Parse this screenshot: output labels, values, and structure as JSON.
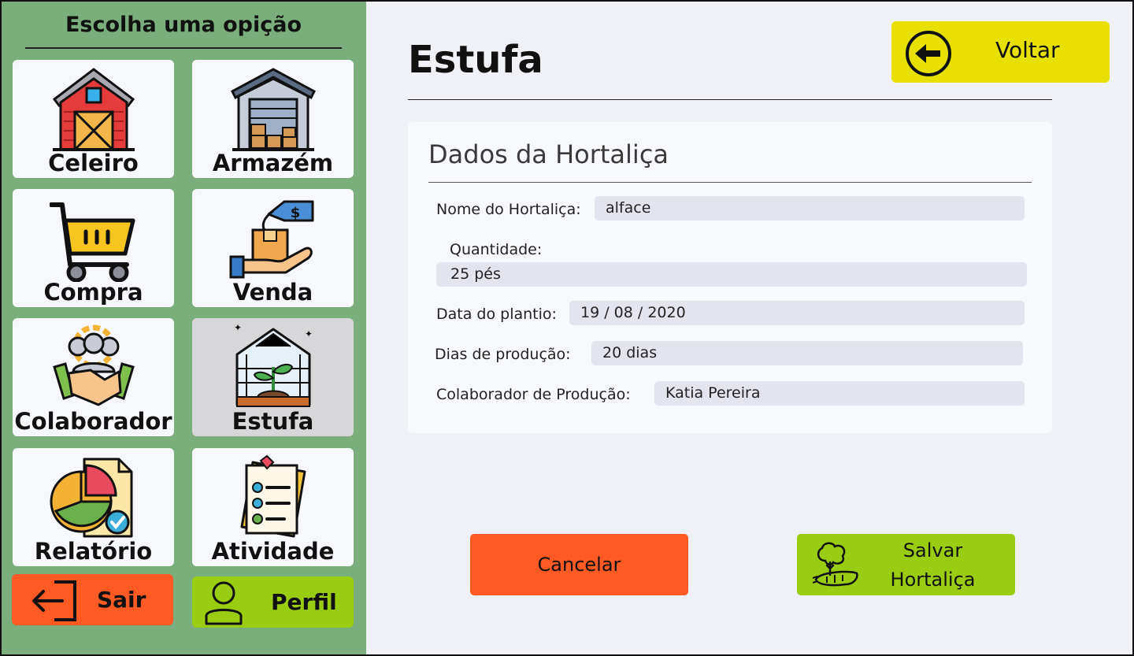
{
  "sidebar": {
    "title": "Escolha uma opição",
    "tiles": [
      {
        "label": "Celeiro",
        "icon": "barn-icon"
      },
      {
        "label": "Armazém",
        "icon": "warehouse-icon"
      },
      {
        "label": "Compra",
        "icon": "shopping-cart-icon"
      },
      {
        "label": "Venda",
        "icon": "sale-box-hand-icon"
      },
      {
        "label": "Colaborador",
        "icon": "handshake-team-icon"
      },
      {
        "label": "Estufa",
        "icon": "greenhouse-icon"
      },
      {
        "label": "Relatório",
        "icon": "report-chart-icon"
      },
      {
        "label": "Atividade",
        "icon": "checklist-icon"
      }
    ],
    "active": "Estufa",
    "logout_label": "Sair",
    "profile_label": "Perfil"
  },
  "header": {
    "title": "Estufa",
    "back_label": "Voltar"
  },
  "form": {
    "title": "Dados da Hortaliça",
    "fields": {
      "name": {
        "label": "Nome do Hortaliça:",
        "value": "alface"
      },
      "quantity": {
        "label": "Quantidade:",
        "value": "25 pés"
      },
      "plant_date": {
        "label": "Data do plantio:",
        "value": "19 / 08 / 2020"
      },
      "production_days": {
        "label": "Dias de produção:",
        "value": "20 dias"
      },
      "collaborator": {
        "label": "Colaborador de Produção:",
        "value": "Katia Pereira"
      }
    }
  },
  "actions": {
    "cancel_label": "Cancelar",
    "save_label_line1": "Salvar",
    "save_label_line2": "Hortaliça"
  },
  "colors": {
    "sidebar_bg": "#7aae7c",
    "back_button": "#e8e000",
    "cancel_button": "#ff5a24",
    "save_button": "#9acd12",
    "logout_button": "#ff5a24",
    "profile_button": "#9acd12"
  }
}
